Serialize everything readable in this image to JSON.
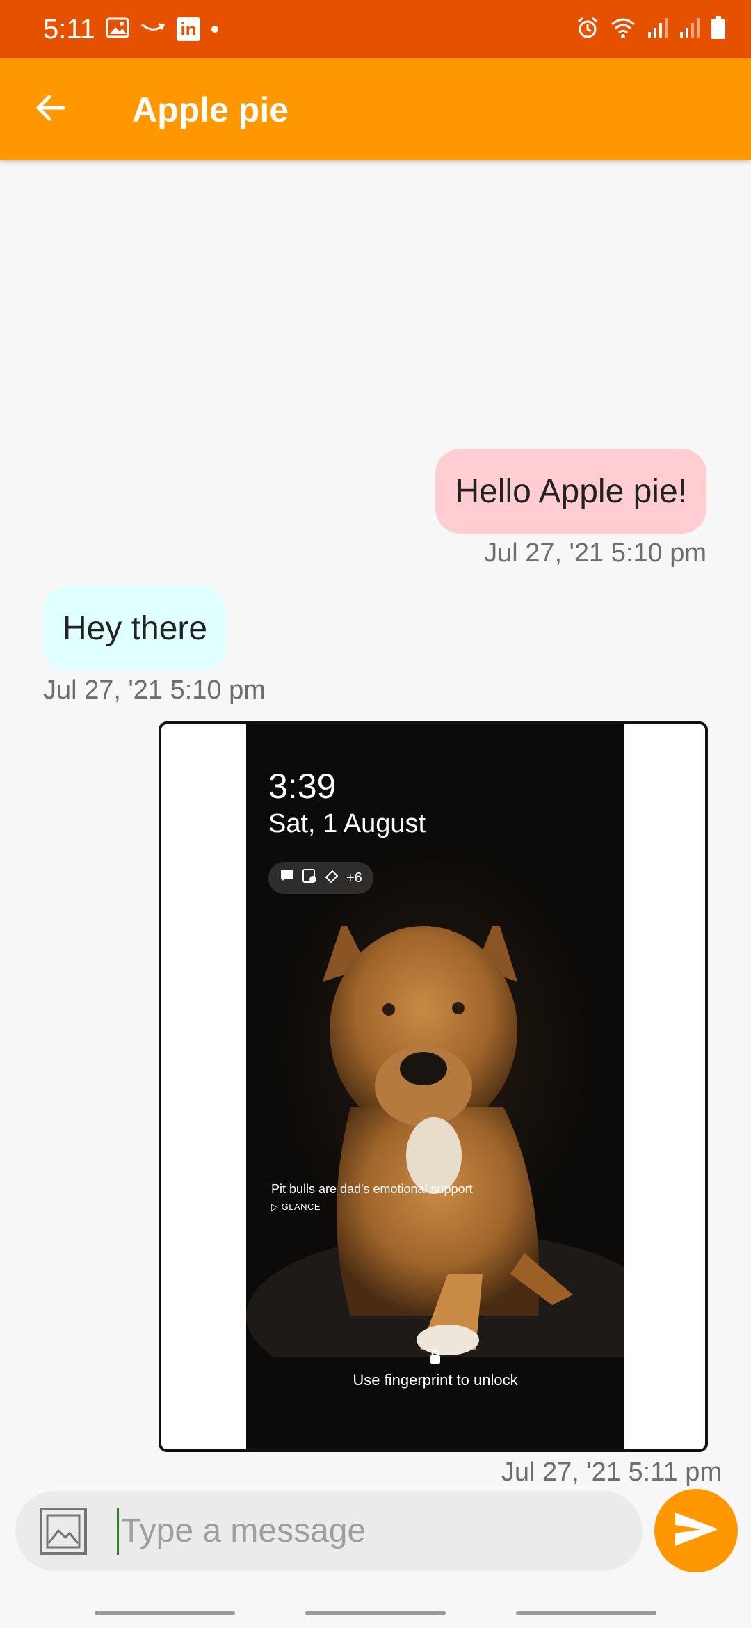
{
  "status_bar": {
    "time": "5:11",
    "left_icons": [
      "gallery-icon",
      "amazon-smile-icon",
      "linkedin-icon",
      "dot-icon"
    ],
    "right_icons": [
      "alarm-icon",
      "wifi-icon",
      "signal-icon",
      "signal-icon",
      "battery-icon"
    ],
    "linkedin_text": "in"
  },
  "app_bar": {
    "title": "Apple pie",
    "back_icon": "back-arrow-icon",
    "color": "#ff9800"
  },
  "messages": [
    {
      "direction": "sent",
      "text": "Hello Apple pie!",
      "timestamp": "Jul 27, '21 5:10 pm",
      "color": "#ffcdd2"
    },
    {
      "direction": "received",
      "text": "Hey there",
      "timestamp": "Jul 27, '21 5:10 pm",
      "color": "#e0ffff"
    },
    {
      "direction": "sent",
      "type": "image",
      "timestamp": "Jul 27, '21 5:11 pm",
      "image_content": {
        "time": "3:39",
        "date": "Sat, 1 August",
        "chip_count": "+6",
        "caption": "Pit bulls are dad's emotional support",
        "glance_label": "GLANCE",
        "unlock_text": "Use fingerprint to unlock"
      }
    }
  ],
  "composer": {
    "placeholder": "Type a message",
    "value": "",
    "send_color": "#ff9800"
  },
  "status_color": "#e65100"
}
